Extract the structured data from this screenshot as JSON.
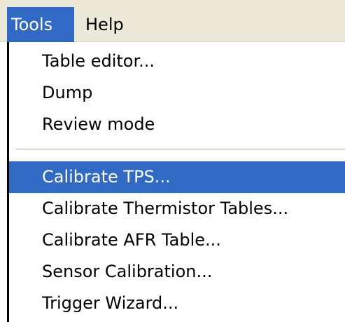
{
  "menubar": {
    "items": [
      {
        "label": "Tools",
        "active": true
      },
      {
        "label": "Help",
        "active": false
      }
    ]
  },
  "tools_menu": {
    "group1": [
      {
        "label": "Table editor..."
      },
      {
        "label": "Dump"
      },
      {
        "label": "Review mode"
      }
    ],
    "group2": [
      {
        "label": "Calibrate TPS...",
        "highlighted": true
      },
      {
        "label": "Calibrate Thermistor Tables..."
      },
      {
        "label": "Calibrate AFR Table..."
      },
      {
        "label": "Sensor Calibration..."
      },
      {
        "label": "Trigger Wizard..."
      }
    ]
  },
  "colors": {
    "highlight": "#316ac5",
    "menubar_bg": "#ece9d8",
    "menu_bg": "#ffffff"
  }
}
